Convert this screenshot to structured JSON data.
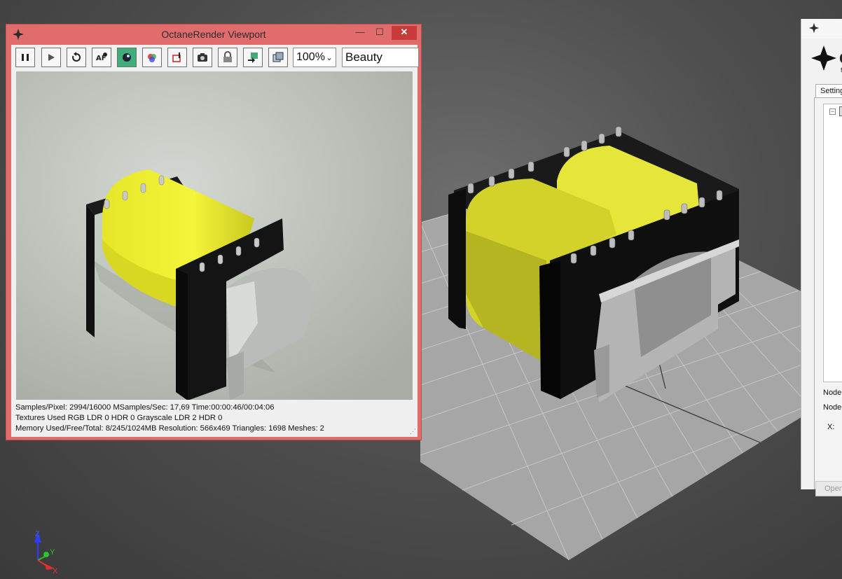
{
  "viewport_window": {
    "title": "OctaneRender Viewport",
    "buttons": {
      "minimize": "—",
      "maximize": "☐",
      "close": "✕"
    },
    "toolbar": {
      "zoom_value": "100%",
      "render_pass_value": "Beauty"
    },
    "stats": {
      "line1": "Samples/Pixel: 2994/16000   MSamples/Sec: 17,69   Time:00:00:46/00:04:06",
      "line2": "Textures Used RGB LDR 0   HDR 0   Grayscale LDR 2   HDR 0",
      "line3": "Memory Used/Free/Total: 8/245/1024MB   Resolution: 566x469   Triangles: 1698   Meshes:  2"
    }
  },
  "side_panel": {
    "header_letter": "O",
    "header_sub": "f",
    "tab_label": "Settings",
    "node_label_1": "Node",
    "node_label_2": "Node",
    "x_label": "X:",
    "open_button": "Open"
  },
  "axis_gizmo": {
    "z": "Z",
    "y": "Y",
    "x": "X"
  },
  "colors": {
    "window_frame": "#e06c6c",
    "close_button": "#c73b3b",
    "active_toolbar_button": "#3fae7a",
    "coil_yellow": "#d8d82a",
    "bobbin_black": "#111111",
    "clip_grey": "#b4b4b4"
  },
  "icons": [
    "octane-logo-icon",
    "pause-icon",
    "play-icon",
    "restart-icon",
    "autofocus-icon",
    "region-render-icon",
    "color-picker-icon",
    "pick-icon",
    "camera-icon",
    "lock-icon",
    "export-icon",
    "copy-icon"
  ]
}
